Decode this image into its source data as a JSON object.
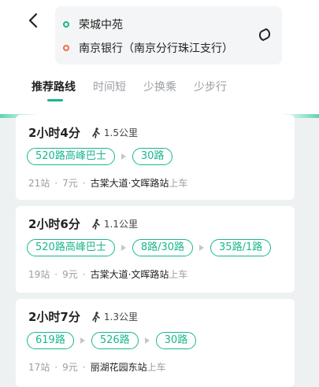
{
  "header": {
    "start": "荣城中苑",
    "end": "南京银行（南京分行珠江支行）"
  },
  "tabs": [
    "推荐路线",
    "时间短",
    "少换乘",
    "少步行"
  ],
  "routes": [
    {
      "duration": "2小时4分",
      "walk": "1.5公里",
      "lines": [
        "520路高峰巴士",
        "30路"
      ],
      "stops": "21站",
      "price": "7元",
      "board_stop": "古棠大道·文晖路站",
      "board_suffix": "上车"
    },
    {
      "duration": "2小时6分",
      "walk": "1.1公里",
      "lines": [
        "520路高峰巴士",
        "8路/30路",
        "35路/1路"
      ],
      "stops": "19站",
      "price": "9元",
      "board_stop": "古棠大道·文晖路站",
      "board_suffix": "上车"
    },
    {
      "duration": "2小时7分",
      "walk": "1.3公里",
      "lines": [
        "619路",
        "526路",
        "30路"
      ],
      "stops": "17站",
      "price": "9元",
      "board_stop": "丽湖花园东站",
      "board_suffix": "上车"
    }
  ],
  "separator": "·",
  "colors": {
    "accent": "#19b68f",
    "end_dot": "#f26b4f"
  }
}
